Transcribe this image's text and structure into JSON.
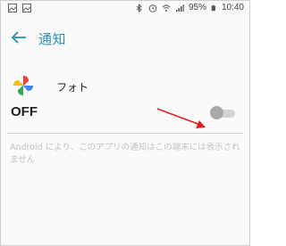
{
  "status_bar": {
    "battery_percent": "95%",
    "time": "10:40",
    "left_icons": [
      "image-icon",
      "image-icon"
    ],
    "right_icons": [
      "bluetooth-icon",
      "alarm-icon",
      "wifi-icon",
      "signal-icon",
      "battery-icon"
    ]
  },
  "header": {
    "title": "通知",
    "back_icon": "arrow-left-icon",
    "accent_color": "#2b8fae"
  },
  "app": {
    "name": "フォト",
    "icon": "google-photos-icon"
  },
  "notification_toggle": {
    "label": "OFF",
    "enabled": false
  },
  "description": "Android により、このアプリの通知はこの端末には表示されません",
  "annotation": {
    "icon": "red-arrow-icon",
    "color": "#e02020"
  }
}
